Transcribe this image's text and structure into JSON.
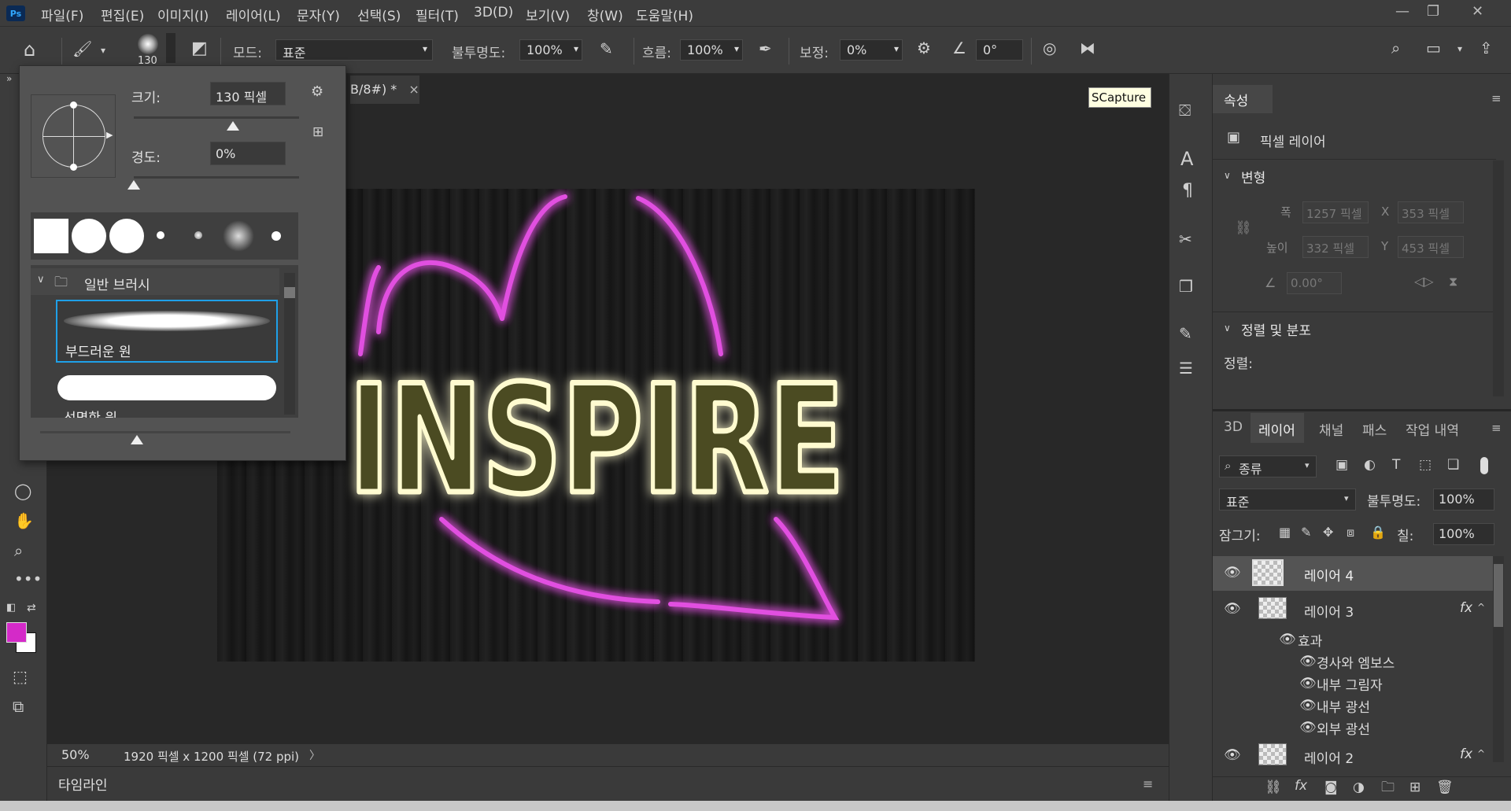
{
  "app": {
    "logo": "Ps"
  },
  "menu": [
    "파일(F)",
    "편집(E)",
    "이미지(I)",
    "레이어(L)",
    "문자(Y)",
    "선택(S)",
    "필터(T)",
    "3D(D)",
    "보기(V)",
    "창(W)",
    "도움말(H)"
  ],
  "options": {
    "brush_size": "130",
    "mode_label": "모드:",
    "mode_value": "표준",
    "opacity_label": "불투명도:",
    "opacity_value": "100%",
    "flow_label": "흐름:",
    "flow_value": "100%",
    "smoothing_label": "보정:",
    "smoothing_value": "0%",
    "angle_value": "0°"
  },
  "document": {
    "tab_title": "B/8#) *",
    "close": "×",
    "zoom": "50%",
    "info": "1920 픽셀 x 1200 픽셀 (72 ppi)",
    "artwork_text": "INSPIRE"
  },
  "tooltip": "SCapture",
  "brush_panel": {
    "size_label": "크기:",
    "size_value": "130 픽셀",
    "hardness_label": "경도:",
    "hardness_value": "0%",
    "size_fraction": 0.6,
    "hardness_fraction": 0.0,
    "folder_name": "일반 브러시",
    "brushes": [
      "부드러운 원",
      "선명한 원"
    ]
  },
  "properties": {
    "tab": "속성",
    "layer_type": "픽셀 레이어",
    "transform_section": "변형",
    "width_label": "폭",
    "width_value": "1257 픽셀",
    "height_label": "높이",
    "height_value": "332 픽셀",
    "x_label": "X",
    "x_value": "353 픽셀",
    "y_label": "Y",
    "y_value": "453 픽셀",
    "angle_value": "0.00°",
    "align_section": "정렬 및 분포",
    "align_label": "정렬:"
  },
  "layers_panel": {
    "tabs": [
      "3D",
      "레이어",
      "채널",
      "패스",
      "작업 내역"
    ],
    "active_tab": "레이어",
    "filter_label": "종류",
    "blend_mode": "표준",
    "opacity_label": "불투명도:",
    "opacity_value": "100%",
    "lock_label": "잠그기:",
    "fill_label": "칠:",
    "fill_value": "100%",
    "layers": [
      {
        "name": "레이어 4",
        "fx": ""
      },
      {
        "name": "레이어 3",
        "fx": "fx"
      },
      {
        "name": "레이어 2",
        "fx": "fx"
      }
    ],
    "effects_label": "효과",
    "effects": [
      "경사와 엠보스",
      "내부 그림자",
      "내부 광선",
      "외부 광선"
    ]
  },
  "timeline": {
    "label": "타임라인"
  },
  "colors": {
    "foreground": "#d42ac8",
    "background": "#ffffff",
    "neon_pink": "#e040e0",
    "neon_yellow": "#fffbd0",
    "accent": "#31a8ff"
  }
}
